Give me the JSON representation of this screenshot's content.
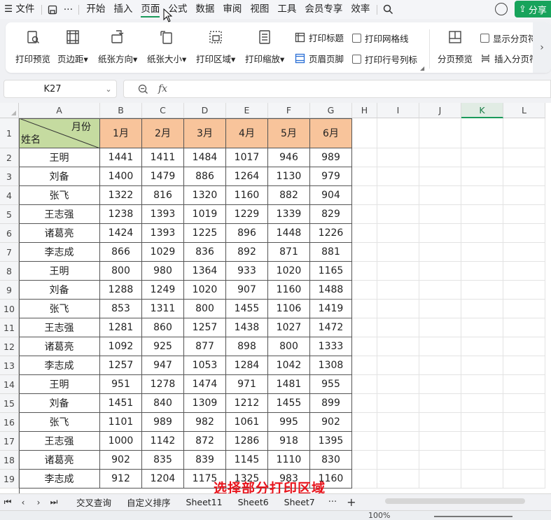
{
  "menubar": {
    "file_label": "文件",
    "items": [
      "开始",
      "插入",
      "页面",
      "公式",
      "数据",
      "审阅",
      "视图",
      "工具",
      "会员专享",
      "效率"
    ],
    "active_item": "页面",
    "share_label": "分享"
  },
  "ribbon": {
    "print_preview": "打印预览",
    "margins": "页边距",
    "orientation": "纸张方向",
    "size": "纸张大小",
    "print_area": "打印区域",
    "print_scale": "打印缩放",
    "print_titles": "打印标题",
    "header_footer": "页眉页脚",
    "print_gridlines": "打印网格线",
    "print_row_col_headers": "打印行号列标",
    "page_break_preview": "分页预览",
    "show_page_breaks": "显示分页符",
    "insert_page_break": "插入分页符"
  },
  "formula_bar": {
    "name_box": "K27",
    "fx": "fx",
    "formula": ""
  },
  "columns": [
    "A",
    "B",
    "C",
    "D",
    "E",
    "F",
    "G",
    "H",
    "I",
    "J",
    "K",
    "L"
  ],
  "selected_column": "K",
  "table": {
    "header_top_right": "月份",
    "header_bottom_left": "姓名",
    "months": [
      "1月",
      "2月",
      "3月",
      "4月",
      "5月",
      "6月"
    ],
    "row_numbers": [
      "1",
      "2",
      "3",
      "4",
      "5",
      "6",
      "7",
      "8",
      "9",
      "10",
      "11",
      "12",
      "13",
      "14",
      "15",
      "16",
      "17",
      "18",
      "19"
    ],
    "rows": [
      {
        "name": "王明",
        "values": [
          "1441",
          "1411",
          "1484",
          "1017",
          "946",
          "989"
        ]
      },
      {
        "name": "刘备",
        "values": [
          "1400",
          "1479",
          "886",
          "1264",
          "1130",
          "979"
        ]
      },
      {
        "name": "张飞",
        "values": [
          "1322",
          "816",
          "1320",
          "1160",
          "882",
          "904"
        ]
      },
      {
        "name": "王志强",
        "values": [
          "1238",
          "1393",
          "1019",
          "1229",
          "1339",
          "829"
        ]
      },
      {
        "name": "诸葛亮",
        "values": [
          "1424",
          "1393",
          "1225",
          "896",
          "1448",
          "1226"
        ]
      },
      {
        "name": "李志成",
        "values": [
          "866",
          "1029",
          "836",
          "892",
          "871",
          "881"
        ]
      },
      {
        "name": "王明",
        "values": [
          "800",
          "980",
          "1364",
          "933",
          "1020",
          "1165"
        ]
      },
      {
        "name": "刘备",
        "values": [
          "1288",
          "1249",
          "1020",
          "907",
          "1160",
          "1488"
        ]
      },
      {
        "name": "张飞",
        "values": [
          "853",
          "1311",
          "800",
          "1455",
          "1106",
          "1419"
        ]
      },
      {
        "name": "王志强",
        "values": [
          "1281",
          "860",
          "1257",
          "1438",
          "1027",
          "1472"
        ]
      },
      {
        "name": "诸葛亮",
        "values": [
          "1092",
          "925",
          "877",
          "898",
          "800",
          "1333"
        ]
      },
      {
        "name": "李志成",
        "values": [
          "1257",
          "947",
          "1053",
          "1284",
          "1042",
          "1308"
        ]
      },
      {
        "name": "王明",
        "values": [
          "951",
          "1278",
          "1474",
          "971",
          "1481",
          "955"
        ]
      },
      {
        "name": "刘备",
        "values": [
          "1451",
          "840",
          "1309",
          "1212",
          "1455",
          "899"
        ]
      },
      {
        "name": "张飞",
        "values": [
          "1101",
          "989",
          "982",
          "1061",
          "995",
          "902"
        ]
      },
      {
        "name": "王志强",
        "values": [
          "1000",
          "1142",
          "872",
          "1286",
          "918",
          "1395"
        ]
      },
      {
        "name": "诸葛亮",
        "values": [
          "902",
          "835",
          "839",
          "1145",
          "1110",
          "830"
        ]
      },
      {
        "name": "李志成",
        "values": [
          "912",
          "1204",
          "1175",
          "1325",
          "983",
          "1160"
        ]
      }
    ]
  },
  "overlay_caption": "选择部分打印区域",
  "sheet_tabs": [
    "交叉查询",
    "自定义排序",
    "Sheet11",
    "Sheet6",
    "Sheet7"
  ],
  "tab_more": "···",
  "tab_add": "+",
  "status": {
    "zoom": "100%"
  },
  "colors": {
    "month_header_bg": "#f8c49b",
    "diag_header_bg": "#c5dba0",
    "accent": "#17a35b",
    "overlay_text": "#e8141c"
  }
}
